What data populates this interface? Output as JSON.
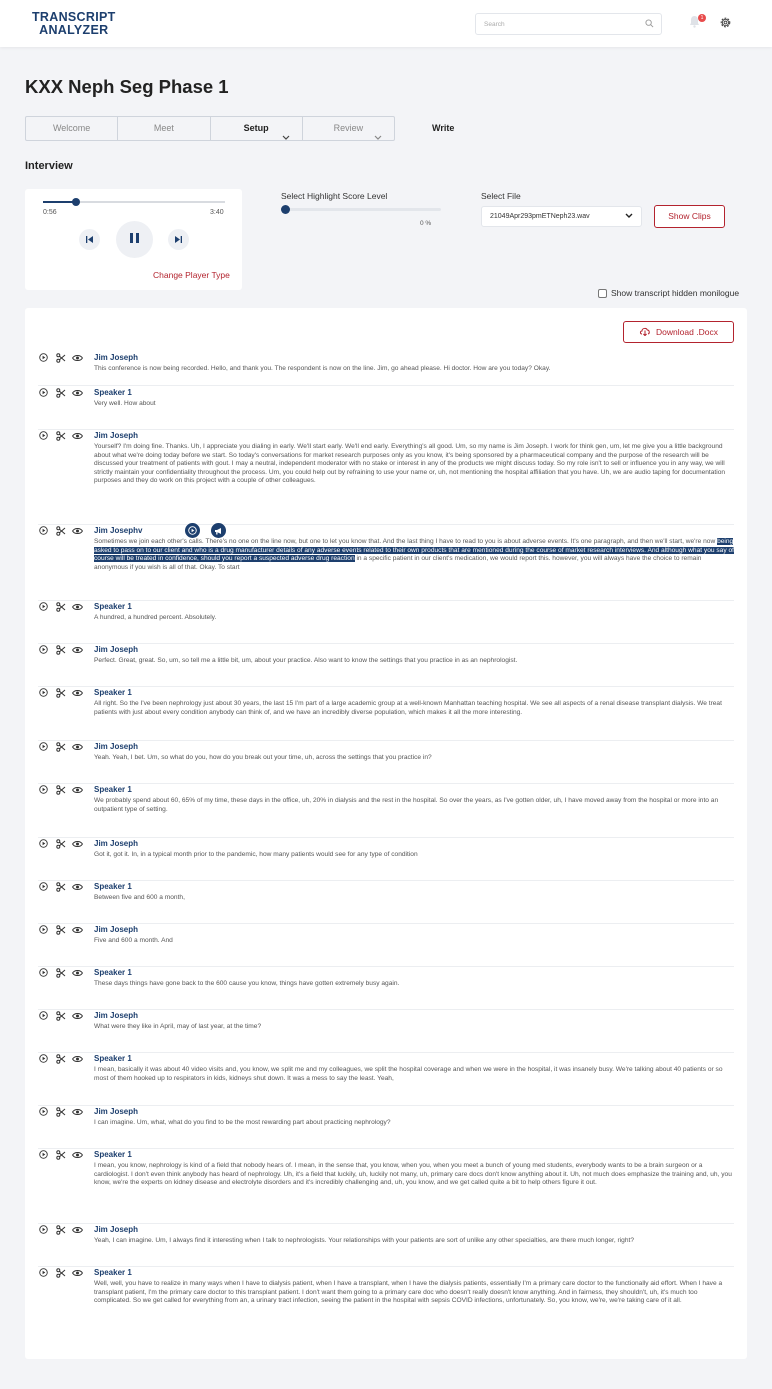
{
  "header": {
    "logo_line1": "TRANSCRIPT",
    "logo_line2": "ANALYZER",
    "search_placeholder": "Search",
    "notification_count": "1"
  },
  "page": {
    "title": "KXX Neph Seg Phase 1"
  },
  "steps": [
    {
      "label": "Welcome"
    },
    {
      "label": "Meet"
    },
    {
      "label": "Setup"
    },
    {
      "label": "Review"
    }
  ],
  "write_label": "Write",
  "section_title": "Interview",
  "player": {
    "current_time": "0:56",
    "duration": "3:40",
    "progress_fraction": 0.18,
    "change_label": "Change Player Type"
  },
  "highlight": {
    "label": "Select Highlight Score Level",
    "value": "0 %",
    "level": 0
  },
  "file": {
    "label": "Select File",
    "selected": "21049Apr293pmETNeph23.wav",
    "show_clips_label": "Show Clips"
  },
  "hidden_monologue_label": "Show transcript hidden monilogue",
  "download_label": "Download .Docx",
  "transcript": [
    {
      "speaker": "Jim Joseph",
      "text": "This conference is now being recorded. Hello, and thank you. The respondent is now on the line. Jim, go ahead please. Hi doctor. How are you today? Okay."
    },
    {
      "speaker": "Speaker 1",
      "text": "Very well. How about"
    },
    {
      "speaker": "Jim Joseph",
      "text": "Yourself? I'm doing fine. Thanks. Uh, I appreciate you dialing in early. We'll start early. We'll end early. Everything's all good. Um, so my name is Jim Joseph. I work for think gen, um, let me give you a little background about what we're doing today before we start. So today's conversations for market research purposes only as you know, it's being sponsored by a pharmaceutical company and the purpose of the research will be discussed your treatment of patients with gout. I may a neutral, independent moderator with no stake or interest in any of the products we might discuss today. So my role isn't to sell or influence you in any way, we will strictly maintain your confidentiality throughout the process. Um, you could help out by refraining to use your name or, uh, not mentioning the hospital affiliation that you have. Uh, we are audio taping for documentation purposes and they do work on this project with a couple of other colleagues."
    },
    {
      "speaker": "Jim Josephv",
      "text_before": "Sometimes we join each other's calls. There's no one on the line now, but one to let you know that. And the last thing I have to read to you is about adverse events. It's one paragraph, and then we'll start, we're now ",
      "text_highlight": "being asked to pass on to our client and who is a drug manufacturer details of any adverse events related to their own products that are mentioned during the course of market research interviews. And although what you say of course will be treated in confidence, should you report a suspected adverse drug reaction",
      "text_after": " in a specific patient in our client's medication, we would report this. however, you will always have the choice to remain anonymous if you wish is all of that. Okay. To start"
    },
    {
      "speaker": "Speaker 1",
      "text": "A hundred, a hundred percent. Absolutely."
    },
    {
      "speaker": "Jim Joseph",
      "text": "Perfect. Great, great. So, um, so tell me a little bit, um, about your practice. Also want to know the settings that you practice in as an nephrologist."
    },
    {
      "speaker": "Speaker 1",
      "text": "All right. So the I've been nephrology just about 30 years, the last 15 I'm part of a large academic group at a well-known Manhattan teaching hospital. We see all aspects of a renal disease transplant dialysis. We treat patients with just about every condition anybody can think of, and we have an incredibly diverse population, which makes it all the more interesting."
    },
    {
      "speaker": "Jim Joseph",
      "text": "Yeah. Yeah, I bet. Um, so what do you, how do you break out your time, uh, across the settings that you practice in?"
    },
    {
      "speaker": "Speaker 1",
      "text": "We probably spend about 60, 65% of my time, these days in the office, uh, 20% in dialysis and the rest in the hospital. So over the years, as I've gotten older, uh, I have moved away from the hospital or more into an outpatient type of setting."
    },
    {
      "speaker": "Jim Joseph",
      "text": "Got it, got it. In, in a typical month prior to the pandemic, how many patients would see for any type of condition"
    },
    {
      "speaker": "Speaker 1",
      "text": "Between five and 600 a month,"
    },
    {
      "speaker": "Jim Joseph",
      "text": "Five and 600 a month. And"
    },
    {
      "speaker": "Speaker 1",
      "text": "These days things have gone back to the 600 cause you know, things have gotten extremely busy again."
    },
    {
      "speaker": "Jim Joseph",
      "text": "What were they like in April, may of last year, at the time?"
    },
    {
      "speaker": "Speaker 1",
      "text": "I mean, basically it was about 40 video visits and, you know, we split me and my colleagues, we split the hospital coverage and when we were in the hospital, it was insanely busy. We're talking about 40 patients or so most of them hooked up to respirators in kids, kidneys shut down. It was a mess to say the least. Yeah,"
    },
    {
      "speaker": "Jim Joseph",
      "text": "I can imagine. Um, what, what do you find to be the most rewarding part about practicing nephrology?"
    },
    {
      "speaker": "Speaker 1",
      "text": "I mean, you know, nephrology is kind of a field that nobody hears of. I mean, in the sense that, you know, when you, when you meet a bunch of young med students, everybody wants to be a brain surgeon or a cardiologist. I don't even think anybody has heard of nephrology. Uh, it's a field that luckily, uh, luckily not many, uh, primary care docs don't know anything about it. Uh, not much does emphasize the training and, uh, you know, we're the experts on kidney disease and electrolyte disorders and it's incredibly challenging and, uh, you know, and we get called quite a bit to help others figure it out."
    },
    {
      "speaker": "Jim Joseph",
      "text": "Yeah, I can imagine. Um, I always find it interesting when I talk to nephrologists. Your relationships with your patients are sort of unlike any other specialties, are there much longer, right?"
    },
    {
      "speaker": "Speaker 1",
      "text": "Well, well, you have to realize in many ways when I have to dialysis patient, when I have a transplant, when I have the dialysis patients, essentially I'm a primary care doctor to the functionally aid effort. When I have a transplant patient, I'm the primary care doctor to this transplant patient. I don't want them going to a primary care doc who doesn't really doesn't know anything. And in fairness, they shouldn't, uh, it's much too complicated. So we get called for everything from an, a urinary tract infection, seeing the patient in the hospital with sepsis COVID infections, unfortunately. So, you know, we're, we're taking care of it all."
    }
  ]
}
